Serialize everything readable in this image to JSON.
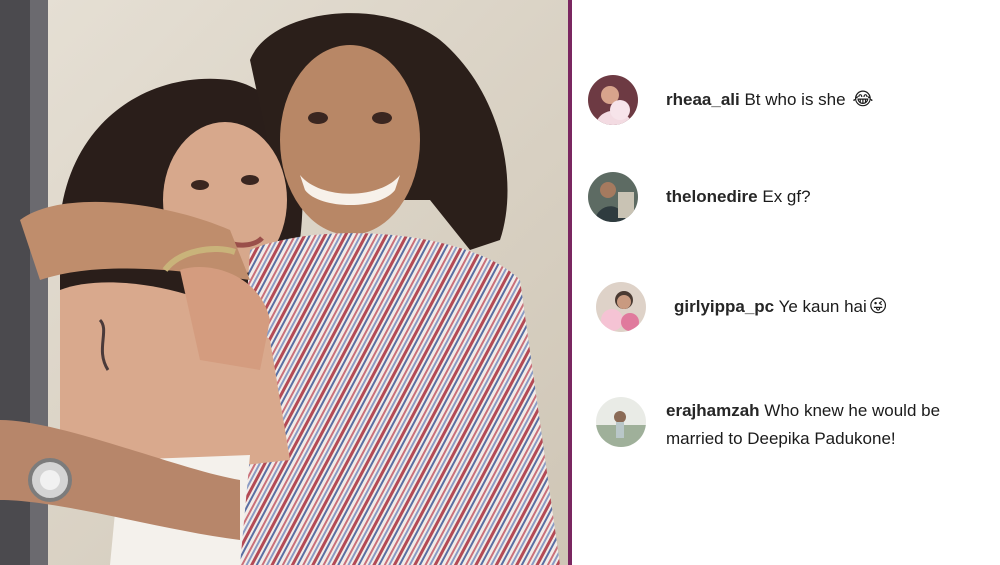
{
  "photo": {
    "alt_icon": "couple-photo"
  },
  "comments": [
    {
      "username": "rheaa_ali",
      "text": "Bt who is she",
      "emoji": "😂",
      "avatar_icon": "avatar-rheaa-ali"
    },
    {
      "username": "thelonedire",
      "text": "Ex gf?",
      "emoji": "",
      "avatar_icon": "avatar-thelonedire"
    },
    {
      "username": "girlyippa_pc",
      "text": "Ye kaun hai",
      "emoji": "😜",
      "avatar_icon": "avatar-girlyippa-pc"
    },
    {
      "username": "erajhamzah",
      "text": "Who knew he would be married to Deepika Padukone!",
      "emoji": "",
      "avatar_icon": "avatar-erajhamzah"
    }
  ],
  "colors": {
    "divider": "#7a2660",
    "username": "#262626",
    "comment_text": "#1b1b1b"
  }
}
